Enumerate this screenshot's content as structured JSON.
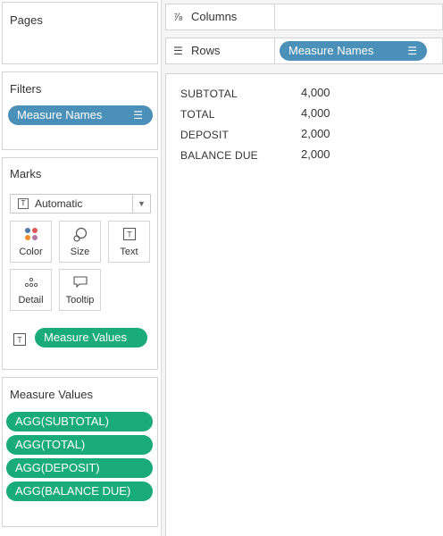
{
  "pages": {
    "title": "Pages"
  },
  "filters": {
    "title": "Filters",
    "pill": "Measure Names"
  },
  "marks": {
    "title": "Marks",
    "mark_type": "Automatic",
    "buttons": [
      "Color",
      "Size",
      "Text",
      "Detail",
      "Tooltip"
    ],
    "text_pill": "Measure Values"
  },
  "measure_values": {
    "title": "Measure Values",
    "items": [
      "AGG(SUBTOTAL)",
      "AGG(TOTAL)",
      "AGG(DEPOSIT)",
      "AGG(BALANCE DUE)"
    ]
  },
  "shelves": {
    "columns_label": "Columns",
    "rows_label": "Rows",
    "rows_pill": "Measure Names"
  },
  "table": {
    "rows": [
      {
        "name": "SUBTOTAL",
        "value": "4,000"
      },
      {
        "name": "TOTAL",
        "value": "4,000"
      },
      {
        "name": "DEPOSIT",
        "value": "2,000"
      },
      {
        "name": "BALANCE DUE",
        "value": "2,000"
      }
    ]
  },
  "colors": {
    "dimension_pill": "#4a90b8",
    "measure_pill": "#1aab7b"
  },
  "icons": {
    "columns": "columns-icon",
    "rows": "rows-icon",
    "sort": "sort-icon",
    "text": "text-icon",
    "color": "color-icon",
    "size": "size-icon",
    "detail": "detail-icon",
    "tooltip": "tooltip-icon",
    "dropdown": "chevron-down-icon"
  }
}
